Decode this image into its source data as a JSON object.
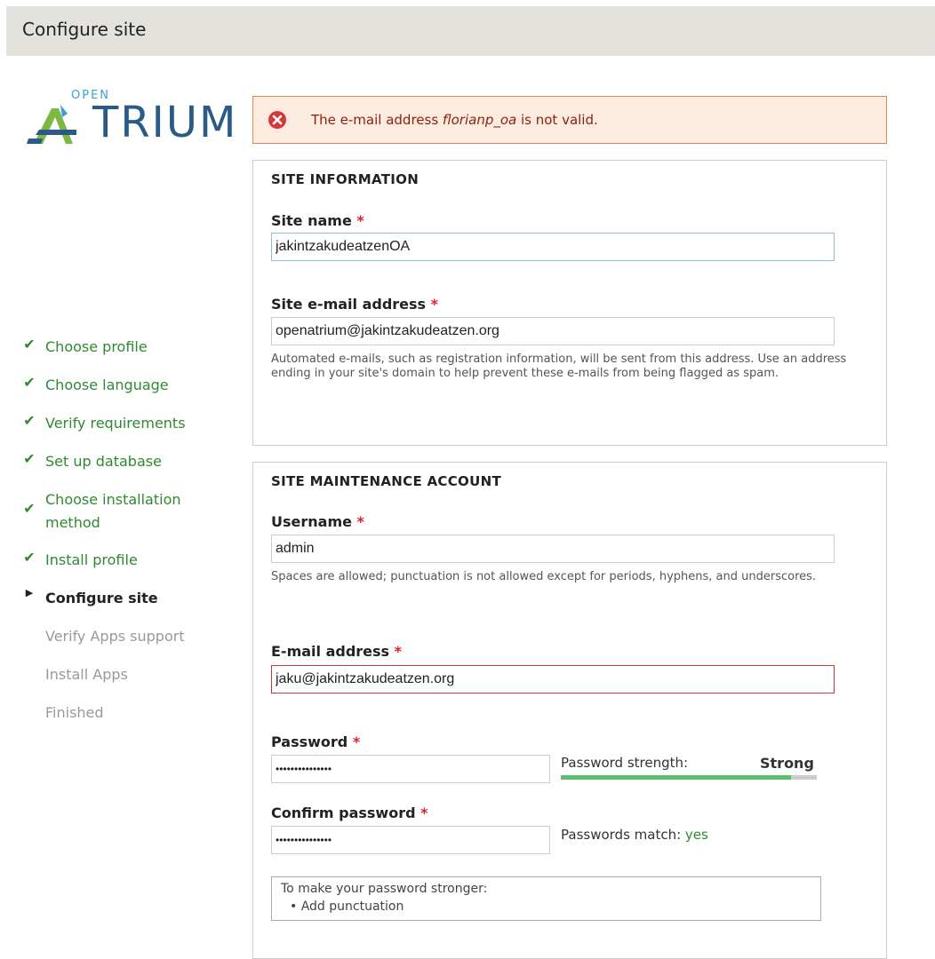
{
  "window": {
    "title": "Configure site"
  },
  "logo": {
    "top_text": "OPEN",
    "main_text": "TRIUM"
  },
  "steps": [
    {
      "label": "Choose profile",
      "state": "done"
    },
    {
      "label": "Choose language",
      "state": "done"
    },
    {
      "label": "Verify requirements",
      "state": "done"
    },
    {
      "label": "Set up database",
      "state": "done"
    },
    {
      "label": "Choose installation method",
      "state": "done"
    },
    {
      "label": "Install profile",
      "state": "done"
    },
    {
      "label": "Configure site",
      "state": "active"
    },
    {
      "label": "Verify Apps support",
      "state": "todo"
    },
    {
      "label": "Install Apps",
      "state": "todo"
    },
    {
      "label": "Finished",
      "state": "todo"
    }
  ],
  "error": {
    "prefix": "The e-mail address ",
    "value": "florianp_oa",
    "suffix": " is not valid."
  },
  "site_info": {
    "legend": "SITE INFORMATION",
    "name_label": "Site name",
    "name_value": "jakintzakudeatzenOA",
    "email_label": "Site e-mail address",
    "email_value": "openatrium@jakintzakudeatzen.org",
    "email_desc": "Automated e-mails, such as registration information, will be sent from this address. Use an address ending in your site's domain to help prevent these e-mails from being flagged as spam."
  },
  "account": {
    "legend": "SITE MAINTENANCE ACCOUNT",
    "username_label": "Username",
    "username_value": "admin",
    "username_desc": "Spaces are allowed; punctuation is not allowed except for periods, hyphens, and underscores.",
    "email_label": "E-mail address",
    "email_value": "jaku@jakintzakudeatzen.org",
    "password_label": "Password",
    "password_value": "•••••••••••••••",
    "strength_label": "Password strength:",
    "strength_value": "Strong",
    "strength_fraction": 0.9,
    "confirm_label": "Confirm password",
    "confirm_value": "•••••••••••••••",
    "match_label": "Passwords match:",
    "match_value": "yes",
    "suggest_title": "To make your password stronger:",
    "suggest_items": [
      "Add punctuation"
    ]
  },
  "required_mark": "*",
  "colors": {
    "accent_green": "#2f8a2f",
    "error_red": "#c23b3b",
    "strength_fill": "#58c26a"
  }
}
